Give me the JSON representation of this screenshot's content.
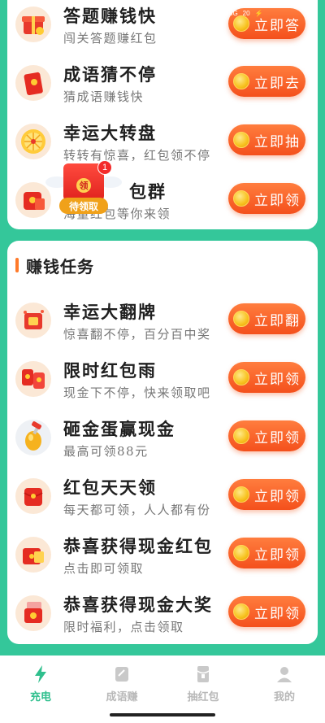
{
  "status_bar": {
    "network": "5G",
    "time": "20",
    "battery": "⚡"
  },
  "top_tasks": [
    {
      "title": "答题赚钱快",
      "subtitle": "闯关答题赚红包",
      "button": "立即答",
      "icon": "gift-box-icon"
    },
    {
      "title": "成语猜不停",
      "subtitle": "猜成语赚钱快",
      "button": "立即去",
      "icon": "red-envelope-icon"
    },
    {
      "title": "幸运大转盘",
      "subtitle": "转转有惊喜，红包领不停",
      "button": "立即抽",
      "icon": "lucky-wheel-icon"
    },
    {
      "title": "包群",
      "subtitle": "海量红包等你来领",
      "button": "立即领",
      "icon": "red-packet-group-icon"
    }
  ],
  "floating_packet": {
    "seal": "领",
    "badge": "1",
    "label": "待领取"
  },
  "earn_section": {
    "title": "赚钱任务",
    "tasks": [
      {
        "title": "幸运大翻牌",
        "subtitle": "惊喜翻不停，百分百中奖",
        "button": "立即翻",
        "icon": "flip-card-icon"
      },
      {
        "title": "限时红包雨",
        "subtitle": "现金下不停，快来领取吧",
        "button": "立即领",
        "icon": "red-envelope-rain-icon"
      },
      {
        "title": "砸金蛋赢现金",
        "subtitle": "最高可领88元",
        "button": "立即领",
        "icon": "golden-egg-icon"
      },
      {
        "title": "红包天天领",
        "subtitle": "每天都可领，人人都有份",
        "button": "立即领",
        "icon": "red-envelope-icon"
      },
      {
        "title": "恭喜获得现金红包",
        "subtitle": "点击即可领取",
        "button": "立即领",
        "icon": "cash-envelope-icon"
      },
      {
        "title": "恭喜获得现金大奖",
        "subtitle": "限时福利，点击领取",
        "button": "立即领",
        "icon": "cash-prize-icon"
      }
    ]
  },
  "bottom_nav": [
    {
      "label": "充电",
      "icon": "lightning-icon",
      "active": true
    },
    {
      "label": "成语赚",
      "icon": "edit-note-icon",
      "active": false
    },
    {
      "label": "抽红包",
      "icon": "red-packet-icon",
      "active": false
    },
    {
      "label": "我的",
      "icon": "user-icon",
      "active": false
    }
  ],
  "colors": {
    "accent": "#34c79a",
    "button": "#f4501c",
    "active_nav": "#2fbf8d"
  }
}
